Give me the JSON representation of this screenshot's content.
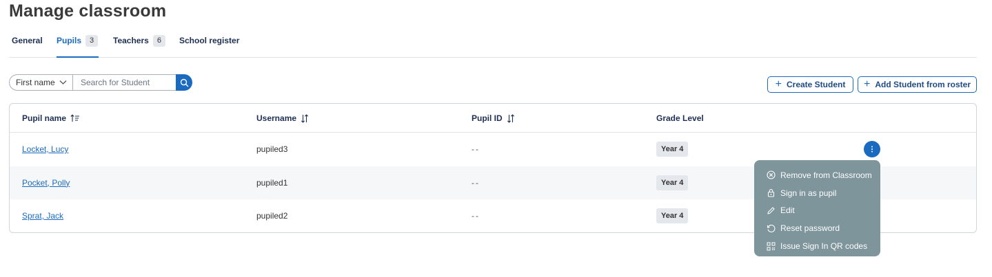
{
  "page": {
    "title": "Manage classroom"
  },
  "tabs": [
    {
      "label": "General",
      "count": ""
    },
    {
      "label": "Pupils",
      "count": "3"
    },
    {
      "label": "Teachers",
      "count": "6"
    },
    {
      "label": "School register",
      "count": ""
    }
  ],
  "active_tab": "Pupils",
  "search": {
    "field_selected": "First name",
    "placeholder": "Search for Student"
  },
  "actions": {
    "create_student": "Create Student",
    "add_from_roster": "Add Student from roster"
  },
  "table": {
    "columns": {
      "pupil_name": "Pupil name",
      "username": "Username",
      "pupil_id": "Pupil ID",
      "grade_level": "Grade Level"
    },
    "rows": [
      {
        "name": "Locket, Lucy",
        "username": "pupiled3",
        "pupil_id": "--",
        "grade": "Year 4"
      },
      {
        "name": "Pocket, Polly",
        "username": "pupiled1",
        "pupil_id": "--",
        "grade": "Year 4"
      },
      {
        "name": "Sprat, Jack",
        "username": "pupiled2",
        "pupil_id": "--",
        "grade": "Year 4"
      }
    ]
  },
  "row_menu": {
    "items": [
      {
        "label": "Remove from Classroom",
        "icon": "circle-x-icon"
      },
      {
        "label": "Sign in as pupil",
        "icon": "lock-icon"
      },
      {
        "label": "Edit",
        "icon": "pencil-icon"
      },
      {
        "label": "Reset password",
        "icon": "reset-icon"
      },
      {
        "label": "Issue Sign In QR codes",
        "icon": "qr-code-icon"
      }
    ]
  },
  "colors": {
    "accent": "#1a6bbf",
    "menu_bg": "#7e959c",
    "badge_bg": "#e4e7eb",
    "title": "#3a3a3a"
  }
}
